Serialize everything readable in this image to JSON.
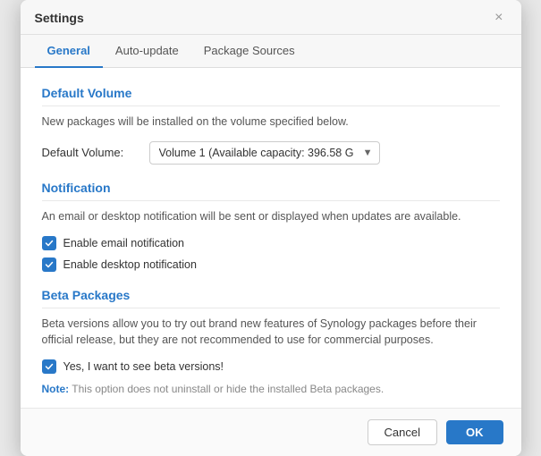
{
  "dialog": {
    "title": "Settings",
    "close_label": "×"
  },
  "tabs": [
    {
      "id": "general",
      "label": "General",
      "active": true
    },
    {
      "id": "auto-update",
      "label": "Auto-update",
      "active": false
    },
    {
      "id": "package-sources",
      "label": "Package Sources",
      "active": false
    }
  ],
  "sections": {
    "default_volume": {
      "title": "Default Volume",
      "description": "New packages will be installed on the volume specified below.",
      "field_label": "Default Volume:",
      "select_value": "Volume 1 (Available capacity:  396.58 G",
      "select_options": [
        "Volume 1 (Available capacity:  396.58 G"
      ]
    },
    "notification": {
      "title": "Notification",
      "description": "An email or desktop notification will be sent or displayed when updates are available.",
      "checkboxes": [
        {
          "id": "email",
          "label": "Enable email notification",
          "checked": true
        },
        {
          "id": "desktop",
          "label": "Enable desktop notification",
          "checked": true
        }
      ]
    },
    "beta_packages": {
      "title": "Beta Packages",
      "description": "Beta versions allow you to try out brand new features of Synology packages before their official release, but they are not recommended to use for commercial purposes.",
      "checkboxes": [
        {
          "id": "beta",
          "label": "Yes, I want to see beta versions!",
          "checked": true
        }
      ],
      "note_label": "Note:",
      "note_text": " This option does not uninstall or hide the installed Beta packages."
    }
  },
  "footer": {
    "cancel_label": "Cancel",
    "ok_label": "OK"
  }
}
